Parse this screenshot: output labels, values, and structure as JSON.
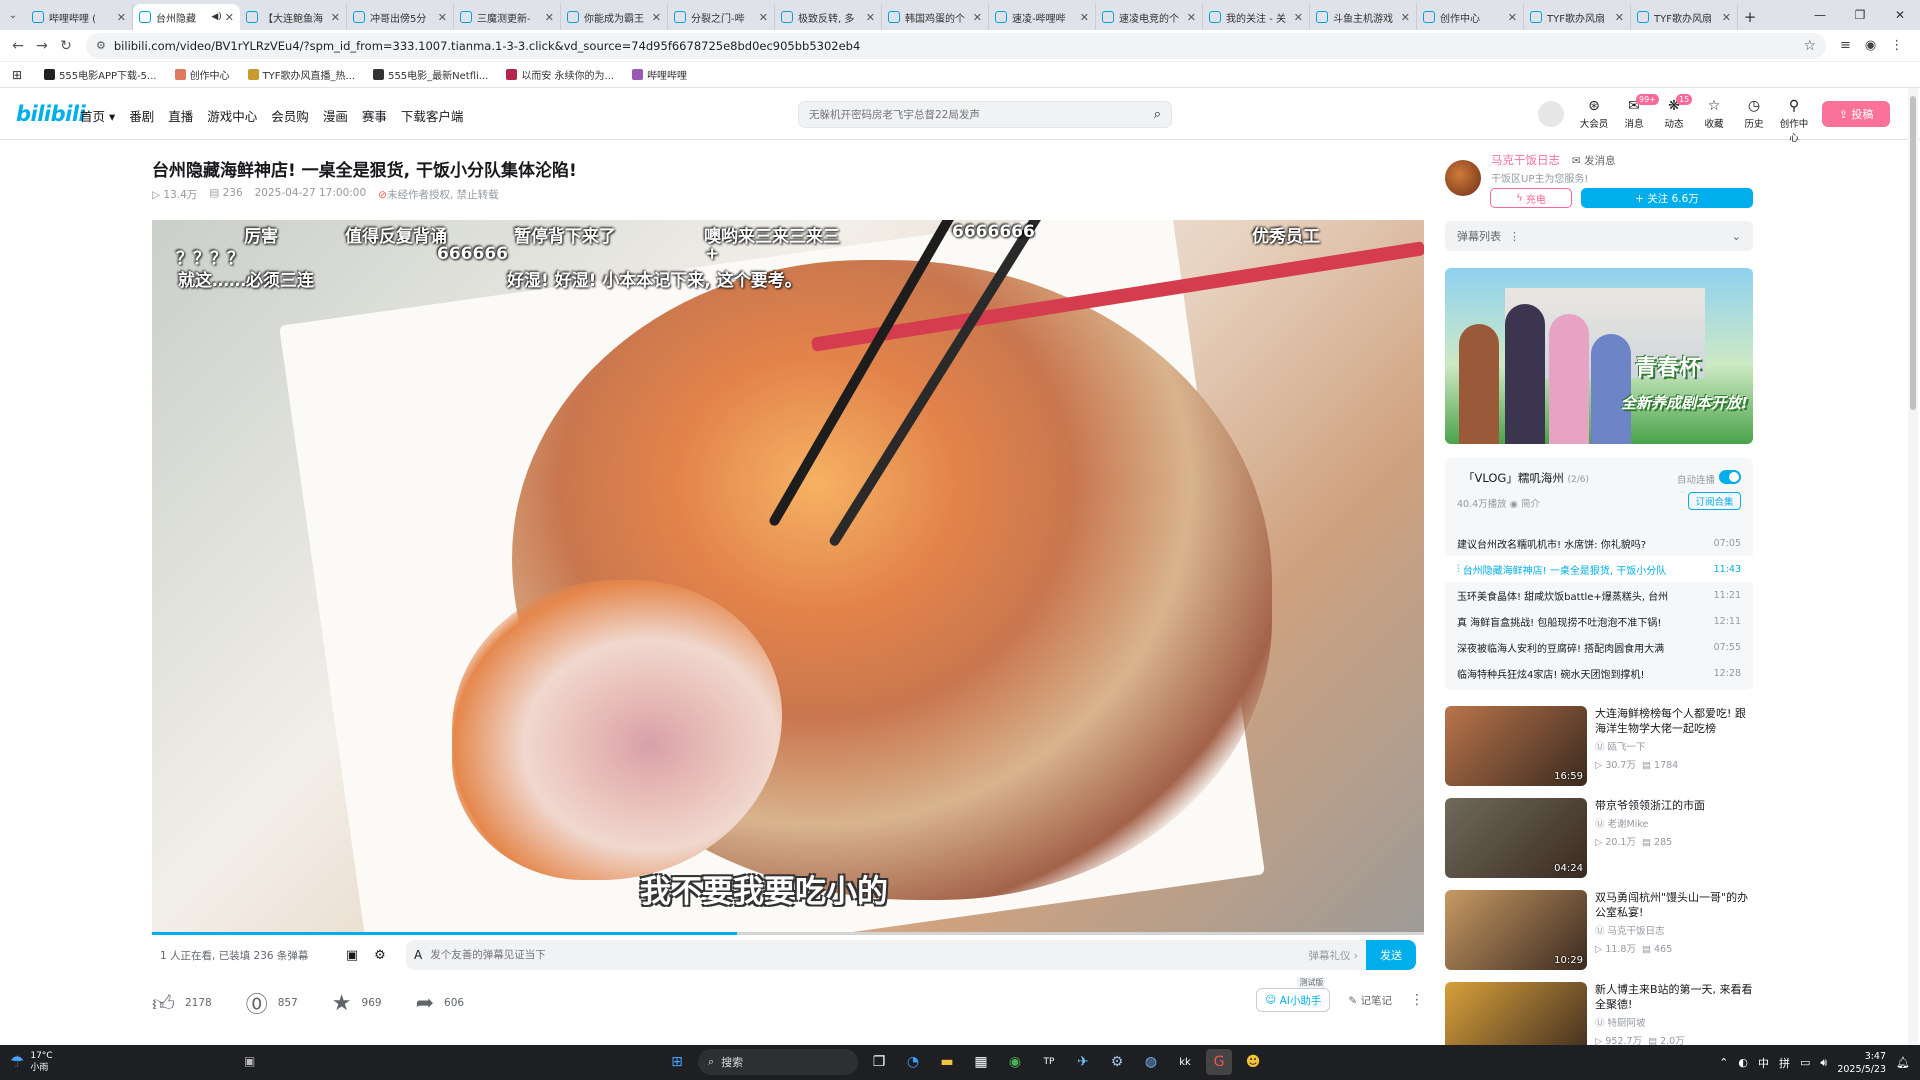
{
  "browser": {
    "tabs": [
      {
        "title": "哔哩哔哩 ("
      },
      {
        "title": "台州隐藏",
        "active": true
      },
      {
        "title": "【大连鲍鱼海"
      },
      {
        "title": "冲哥出傍5分"
      },
      {
        "title": "三魔测更新-"
      },
      {
        "title": "你能成为霸王"
      },
      {
        "title": "分裂之门-哔"
      },
      {
        "title": "极致反转, 多"
      },
      {
        "title": "韩国鸡蛋的个"
      },
      {
        "title": "速凌-哔哩哔"
      },
      {
        "title": "速凌电竞的个"
      },
      {
        "title": "我的关注 - 关"
      },
      {
        "title": "斗鱼主机游戏"
      },
      {
        "title": "创作中心"
      },
      {
        "title": "TYF歌办风扇"
      },
      {
        "title": "TYF歌办风扇"
      }
    ],
    "url": "bilibili.com/video/BV1rYLRzVEu4/?spm_id_from=333.1007.tianma.1-3-3.click&vd_source=74d95f6678725e8bd0ec905bb5302eb4",
    "bookmarks": [
      "555电影APP下载-5...",
      "创作中心",
      "TYF歌办风直播_热...",
      "555电影_最新Netfli...",
      "以而安 永续你的为...",
      "哔哩哔哩"
    ]
  },
  "header": {
    "logo": "bilibili",
    "nav": [
      "首页 ▾",
      "番剧",
      "直播",
      "游戏中心",
      "会员购",
      "漫画",
      "赛事",
      "下载客户端"
    ],
    "search_placeholder": "无躲机开密码房老飞宇总督22局发声",
    "icons": [
      {
        "label": "大会员",
        "glyph": "⊛",
        "badge": ""
      },
      {
        "label": "消息",
        "glyph": "✉",
        "badge": "99+"
      },
      {
        "label": "动态",
        "glyph": "❋",
        "badge": "15"
      },
      {
        "label": "收藏",
        "glyph": "☆",
        "badge": ""
      },
      {
        "label": "历史",
        "glyph": "◷",
        "badge": ""
      },
      {
        "label": "创作中心",
        "glyph": "⚲",
        "badge": ""
      }
    ],
    "upload": "投稿"
  },
  "video": {
    "title": "台州隐藏海鲜神店! 一桌全是狠货, 干饭小分队集体沦陷!",
    "views": "13.4万",
    "danmaku_count": "236",
    "date": "2025-04-27 17:00:00",
    "copyright": "未经作者授权, 禁止转载",
    "danmaku": [
      "厉害",
      "值得反复背诵",
      "暂停背下来了",
      "噢哟来三来三来三",
      "6666666",
      "优秀员工",
      "？？？？",
      "666666",
      "就这……必须三连",
      "好湿! 好湿! 小本本记下来, 这个要考。",
      "+"
    ],
    "subtitle": "我不要我要吃小的",
    "progress": 0.46,
    "viewers": "1 人正在看, 已装填 236 条弹幕",
    "dm_placeholder": "发个友善的弹幕见证当下",
    "dm_etiquette": "弹幕礼仪 ›",
    "dm_send": "发送",
    "like": "2178",
    "coin": "857",
    "fav": "969",
    "share": "606",
    "ai_beta": "测试版",
    "ai_label": "AI小助手",
    "note_label": "记笔记"
  },
  "up": {
    "name": "马克干饭日志",
    "message": "发消息",
    "desc": "干饭区UP主为您服务!",
    "charge": "充电",
    "follow": "+ 关注 6.6万"
  },
  "danmaku_list": {
    "label": "弹幕列表",
    "more": "⋮"
  },
  "ad": {
    "title": "青春杯",
    "subtitle": "全新养成剧本开放!"
  },
  "playlist": {
    "title": "「VLOG」糯叽海州",
    "progress": "(2/6)",
    "autoplay": "自动连播",
    "stats": "40.4万播放  ◉ 简介",
    "subscribe": "订阅合集",
    "items": [
      {
        "title": "建议台州改名糯叽机市! 水席饼: 你礼貌吗?",
        "dur": "07:05",
        "current": false
      },
      {
        "title": "台州隐藏海鲜神店! 一桌全是狠货, 干饭小分队",
        "dur": "11:43",
        "current": true
      },
      {
        "title": "玉环美食晶体! 甜咸炊饭battle+爆蒸糕头, 台州",
        "dur": "11:21",
        "current": false
      },
      {
        "title": "真 海鲜盲盒挑战! 包船现捞不吐泡泡不准下锅!",
        "dur": "12:11",
        "current": false
      },
      {
        "title": "深夜被临海人安利的豆腐碎! 搭配肉圆食用大满",
        "dur": "07:55",
        "current": false
      },
      {
        "title": "临海特种兵狂炫4家店! 碗水天团饱到撑机!",
        "dur": "12:28",
        "current": false
      }
    ]
  },
  "recommendations": [
    {
      "title": "大连海鲜榜榜每个人都爱吃! 跟海洋生物学大佬一起吃榜",
      "author": "瓯飞一下",
      "views": "30.7万",
      "dm": "1784",
      "dur": "16:59",
      "thumb": "#b9754a"
    },
    {
      "title": "带京爷领领浙江的市面",
      "author": "老谢Mike",
      "views": "20.1万",
      "dm": "285",
      "dur": "04:24",
      "thumb": "#6e6a5c"
    },
    {
      "title": "双马勇闯杭州\"馒头山一哥\"的办公室私宴!",
      "author": "马克干饭日志",
      "views": "11.8万",
      "dm": "465",
      "dur": "10:29",
      "thumb": "#c79a63"
    },
    {
      "title": "新人博主来B站的第一天, 来看看全聚德!",
      "author": "特厨阿坡",
      "views": "952.7万",
      "dm": "2.0万",
      "dur": "",
      "thumb": "#d8a03a"
    }
  ],
  "taskbar": {
    "temp": "17°C",
    "weather": "小雨",
    "search": "搜索",
    "time": "3:47",
    "date": "2025/5/23",
    "ime": "中",
    "ime2": "拼"
  }
}
